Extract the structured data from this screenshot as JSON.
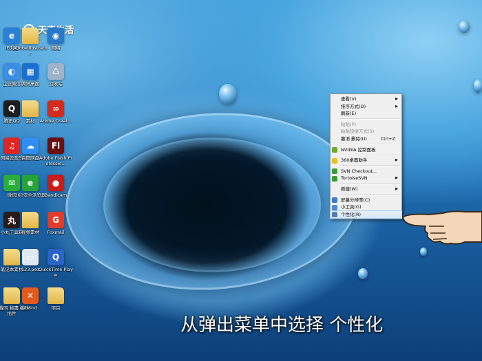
{
  "watermark": {
    "text": "天奇生活"
  },
  "desktop_icons": [
    {
      "label": "IE浏览",
      "icon": "ie-icon",
      "color": "#2a7fd6",
      "glyph": "e"
    },
    {
      "label": "AdobeIllustrator",
      "icon": "folder-icon",
      "color": "folder",
      "glyph": ""
    },
    {
      "label": "网络",
      "icon": "network-icon",
      "color": "#2a78c8",
      "glyph": "◉"
    },
    {
      "label": "企业微信",
      "icon": "wecom-icon",
      "color": "#3a8ee6",
      "glyph": "◐"
    },
    {
      "label": "腾讯桌面",
      "icon": "tencent-desktop-icon",
      "color": "#1a6fd0",
      "glyph": "▦"
    },
    {
      "label": "回收站",
      "icon": "recycle-bin-icon",
      "color": "#9fb4c8",
      "glyph": "♺"
    },
    {
      "label": "腾讯QQ",
      "icon": "qq-icon",
      "color": "#1d1d1d",
      "glyph": "Q"
    },
    {
      "label": "素材",
      "icon": "folder-icon",
      "color": "folder",
      "glyph": ""
    },
    {
      "label": "Adobe Creat...",
      "icon": "adobe-cc-icon",
      "color": "#d62a1c",
      "glyph": "∞"
    },
    {
      "label": "网易云音乐",
      "icon": "netease-music-icon",
      "color": "#e02424",
      "glyph": "♫"
    },
    {
      "label": "百度网盘",
      "icon": "baidu-netdisk-icon",
      "color": "#2f8ef0",
      "glyph": "☁"
    },
    {
      "label": "Adobe Flash Professio...",
      "icon": "flash-icon",
      "color": "#6b1010",
      "glyph": "Fl"
    },
    {
      "label": "微信",
      "icon": "wechat-icon",
      "color": "#2aae3a",
      "glyph": "✉"
    },
    {
      "label": "360安全浏览器",
      "icon": "360-browser-icon",
      "color": "#27a33c",
      "glyph": "e"
    },
    {
      "label": "Bandicam",
      "icon": "bandicam-icon",
      "color": "#c81c1c",
      "glyph": "●"
    },
    {
      "label": "小丸工具箱",
      "icon": "xiaowan-icon",
      "color": "#2a1a1a",
      "glyph": "丸"
    },
    {
      "label": "视频素材",
      "icon": "folder-icon",
      "color": "folder",
      "glyph": ""
    },
    {
      "label": "Foxmail",
      "icon": "foxmail-icon",
      "color": "#e23b2a",
      "glyph": "G"
    },
    {
      "label": "笔记本素材",
      "icon": "folder-icon",
      "color": "folder",
      "glyph": ""
    },
    {
      "label": "123.psd",
      "icon": "psd-file-icon",
      "color": "#dde8f2",
      "glyph": "▭"
    },
    {
      "label": "QuickTime Player",
      "icon": "quicktime-icon",
      "color": "#2a64c4",
      "glyph": "Q"
    },
    {
      "label": "下载同 秘書 播放插件",
      "icon": "folder-icon",
      "color": "folder",
      "glyph": ""
    },
    {
      "label": "XMind",
      "icon": "xmind-icon",
      "color": "#e25a1c",
      "glyph": "✕"
    },
    {
      "label": "项目",
      "icon": "folder-icon",
      "color": "folder",
      "glyph": ""
    }
  ],
  "context_menu": {
    "items": [
      {
        "label": "查看(V)",
        "arrow": "▶",
        "shortcut": "",
        "disabled": false,
        "icon": ""
      },
      {
        "label": "排序方式(O)",
        "arrow": "▶",
        "shortcut": "",
        "disabled": false,
        "icon": ""
      },
      {
        "label": "刷新(E)",
        "arrow": "",
        "shortcut": "",
        "disabled": false,
        "icon": ""
      },
      {
        "sep": true
      },
      {
        "label": "粘贴(P)",
        "arrow": "",
        "shortcut": "",
        "disabled": true,
        "icon": ""
      },
      {
        "label": "粘贴快捷方式(S)",
        "arrow": "",
        "shortcut": "",
        "disabled": true,
        "icon": ""
      },
      {
        "label": "撤消 删除(U)",
        "arrow": "",
        "shortcut": "Ctrl+Z",
        "disabled": false,
        "icon": ""
      },
      {
        "sep": true
      },
      {
        "label": "NVIDIA 控制面板",
        "arrow": "",
        "shortcut": "",
        "disabled": false,
        "icon": "#6aa82a"
      },
      {
        "sep": true
      },
      {
        "label": "360桌面助手",
        "arrow": "▶",
        "shortcut": "",
        "disabled": false,
        "icon": "#e8c020"
      },
      {
        "sep": true
      },
      {
        "label": "SVN Checkout...",
        "arrow": "",
        "shortcut": "",
        "disabled": false,
        "icon": "#3a9a3a"
      },
      {
        "label": "TortoiseSVN",
        "arrow": "▶",
        "shortcut": "",
        "disabled": false,
        "icon": "#3a9a3a"
      },
      {
        "sep": true
      },
      {
        "label": "新建(W)",
        "arrow": "▶",
        "shortcut": "",
        "disabled": false,
        "icon": ""
      },
      {
        "sep": true
      },
      {
        "label": "屏幕分辨率(C)",
        "arrow": "",
        "shortcut": "",
        "disabled": false,
        "icon": "#3a7ac8"
      },
      {
        "label": "小工具(G)",
        "arrow": "",
        "shortcut": "",
        "disabled": false,
        "icon": "#4a8ad8"
      },
      {
        "label": "个性化(R)",
        "arrow": "",
        "shortcut": "",
        "disabled": false,
        "icon": "#5a7ab0",
        "highlight": true
      }
    ]
  },
  "caption": {
    "text": "从弹出菜单中选择 个性化"
  }
}
